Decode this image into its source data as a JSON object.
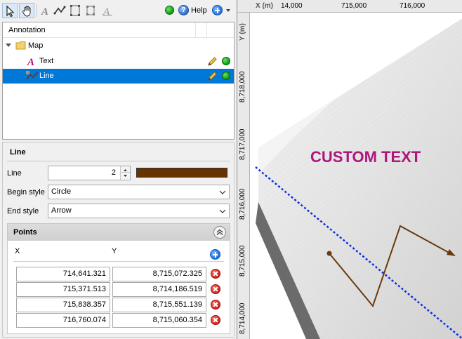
{
  "toolbar": {
    "tools": [
      "select-arrow-icon",
      "pan-hand-icon",
      "text-tool-icon",
      "line-tool-icon",
      "rectangle-tool-icon",
      "stretch-rectangle-icon",
      "text-style-icon"
    ],
    "help_label": "Help"
  },
  "tree": {
    "header": "Annotation",
    "items": [
      {
        "label": "Map",
        "icon": "folder-icon"
      },
      {
        "label": "Text",
        "icon": "text-annotation-icon"
      },
      {
        "label": "Line",
        "icon": "line-annotation-icon",
        "selected": true
      }
    ]
  },
  "properties": {
    "title": "Line",
    "line_label": "Line",
    "line_width": "2",
    "line_color": "#663300",
    "begin_style_label": "Begin style",
    "begin_style": "Circle",
    "end_style_label": "End style",
    "end_style": "Arrow"
  },
  "points": {
    "title": "Points",
    "col_x": "X",
    "col_y": "Y",
    "rows": [
      {
        "x": "714,641.321",
        "y": "8,715,072.325"
      },
      {
        "x": "715,371.513",
        "y": "8,714,186.519"
      },
      {
        "x": "715,838.357",
        "y": "8,715,551.139"
      },
      {
        "x": "716,760.074",
        "y": "8,715,060.354"
      }
    ]
  },
  "map": {
    "x_axis_label": "X (m)",
    "y_axis_label": "Y (m)",
    "x_ticks": [
      "14,000",
      "715,000",
      "716,000"
    ],
    "y_ticks": [
      "8,718,000",
      "8,717,000",
      "8,716,000",
      "8,715,000",
      "8,714,000"
    ],
    "custom_text": "CUSTOM TEXT",
    "custom_text_color": "#b0157c",
    "boundary_color": "#0a2fd8"
  }
}
